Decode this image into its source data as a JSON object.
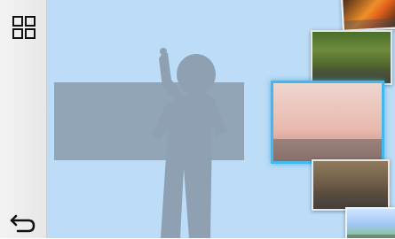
{
  "icons": {
    "grid": "grid-view-icon",
    "back": "back-arrow-icon",
    "silhouette": "person-silhouette-icon",
    "placeholder": "selection-bar"
  },
  "colors": {
    "sidebar": "#e9e9e9",
    "preview_background": "#bcdcf7",
    "selection_border": "#43b8ee",
    "silhouette": "#8ea0b1"
  },
  "thumbnails": [
    {
      "id": "thumb-1",
      "selected": false
    },
    {
      "id": "thumb-2",
      "selected": false
    },
    {
      "id": "thumb-3",
      "selected": true
    },
    {
      "id": "thumb-4",
      "selected": false
    },
    {
      "id": "thumb-5",
      "selected": false
    }
  ]
}
